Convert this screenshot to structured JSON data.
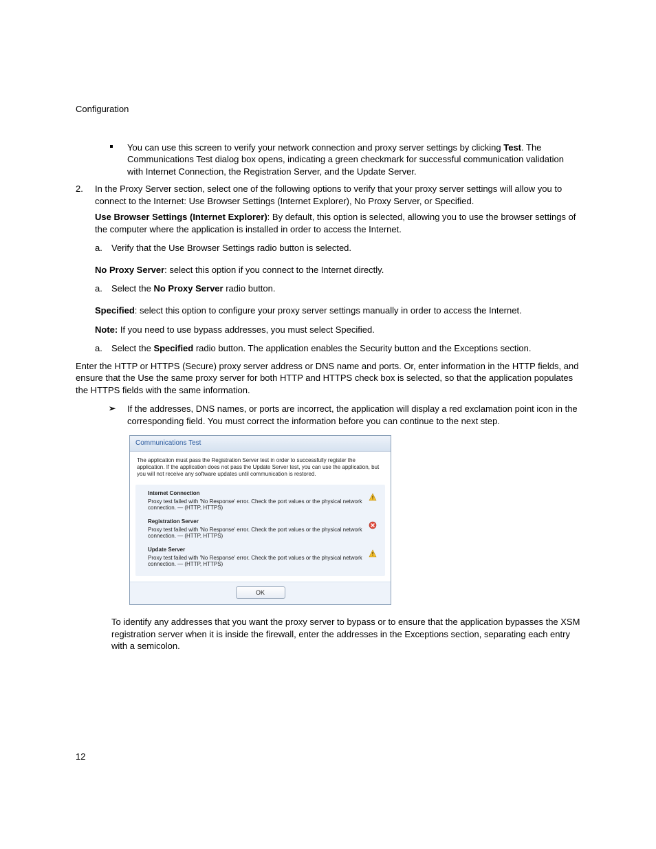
{
  "header": "Configuration",
  "page_number": "12",
  "bullet1_pre": "You can use this screen to verify your network connection and proxy server settings by clicking ",
  "bullet1_bold": "Test",
  "bullet1_post": ". The Communications Test dialog box opens, indicating a green checkmark for successful communication validation with Internet Connection, the Registration Server, and the Update Server.",
  "step2_num": "2.",
  "step2_text": "In the Proxy Server section, select one of the following options to verify that your proxy server settings will allow you to connect to the Internet: Use Browser Settings (Internet Explorer), No Proxy Server, or Specified.",
  "ubs_bold": "Use Browser Settings (Internet Explorer)",
  "ubs_text": ": By default, this option is selected, allowing you to use the browser settings of the computer where the application is installed in order to access the Internet.",
  "ubs_a_letter": "a.",
  "ubs_a_text": "Verify that the Use Browser Settings radio button is selected.",
  "nps_bold": "No Proxy Server",
  "nps_text": ": select this option if you connect to the Internet directly.",
  "nps_a_letter": "a.",
  "nps_a_pre": "Select the ",
  "nps_a_bold": "No Proxy Server",
  "nps_a_post": " radio button.",
  "spec_bold": "Specified",
  "spec_text": ": select this option to configure your proxy server settings manually in order to access the Internet.",
  "note_bold": "Note:",
  "note_text": " If you need to use bypass addresses, you must select Specified.",
  "spec_a_letter": "a.",
  "spec_a_pre": "Select the ",
  "spec_a_bold": "Specified",
  "spec_a_post": " radio button. The application enables the Security button and the Exceptions section.",
  "enter_http": "Enter the HTTP or HTTPS (Secure) proxy server address or DNS name and ports. Or, enter information in the HTTP fields, and ensure that the Use the same proxy server for both HTTP and HTTPS check box is selected, so that the application populates the HTTPS fields with the same information.",
  "arrow_text": "If the addresses, DNS names, or ports are incorrect, the application will display a red exclamation point icon in the corresponding field. You must correct the information before you can continue to the next step.",
  "after_dialog": "To identify any addresses that you want the proxy server to bypass or to ensure that the application bypasses the XSM registration server when it is inside the firewall, enter the addresses in the Exceptions section, separating each entry with a semicolon.",
  "dialog": {
    "title": "Communications Test",
    "intro": "The application must pass the Registration Server test in order to successfully register the application. If the application does not pass the Update Server test, you can use the application, but you will not receive any software updates until communication is restored.",
    "items": [
      {
        "title": "Internet Connection",
        "msg": "Proxy test failed with 'No Response' error. Check the port values or the physical network connection. — (HTTP, HTTPS)",
        "status": "warn"
      },
      {
        "title": "Registration Server",
        "msg": "Proxy test failed with 'No Response' error. Check the port values or the physical network connection. — (HTTP, HTTPS)",
        "status": "error"
      },
      {
        "title": "Update Server",
        "msg": "Proxy test failed with 'No Response' error. Check the port values or the physical network connection. — (HTTP, HTTPS)",
        "status": "warn"
      }
    ],
    "ok": "OK"
  }
}
